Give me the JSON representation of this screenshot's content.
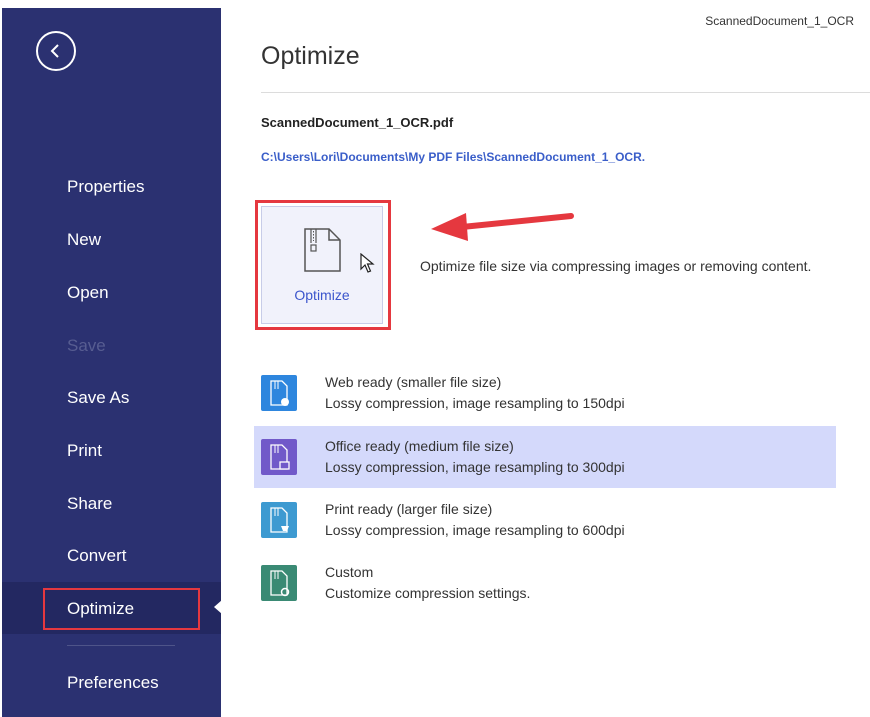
{
  "window": {
    "document_title": "ScannedDocument_1_OCR"
  },
  "sidebar": {
    "items": [
      {
        "label": "Properties",
        "enabled": true
      },
      {
        "label": "New",
        "enabled": true
      },
      {
        "label": "Open",
        "enabled": true
      },
      {
        "label": "Save",
        "enabled": false
      },
      {
        "label": "Save As",
        "enabled": true
      },
      {
        "label": "Print",
        "enabled": true
      },
      {
        "label": "Share",
        "enabled": true
      },
      {
        "label": "Convert",
        "enabled": true
      },
      {
        "label": "Optimize",
        "enabled": true,
        "selected": true
      },
      {
        "label": "Preferences",
        "enabled": true
      }
    ]
  },
  "main": {
    "title": "Optimize",
    "file_name": "ScannedDocument_1_OCR.pdf",
    "file_path": "C:\\Users\\Lori\\Documents\\My PDF Files\\ScannedDocument_1_OCR.",
    "optimize_button_label": "Optimize",
    "optimize_description": "Optimize file size via compressing images or removing content.",
    "presets": [
      {
        "title": "Web ready (smaller file size)",
        "subtitle": "Lossy compression, image resampling to 150dpi",
        "icon": "web-ready-icon",
        "color": "#2e86de",
        "selected": false
      },
      {
        "title": "Office ready (medium file size)",
        "subtitle": "Lossy compression, image resampling to 300dpi",
        "icon": "office-ready-icon",
        "color": "#7159c9",
        "selected": true
      },
      {
        "title": "Print ready (larger file size)",
        "subtitle": "Lossy compression, image resampling to 600dpi",
        "icon": "print-ready-icon",
        "color": "#3d9ad1",
        "selected": false
      },
      {
        "title": "Custom",
        "subtitle": "Customize compression settings.",
        "icon": "custom-icon",
        "color": "#3a8a74",
        "selected": false
      }
    ]
  },
  "colors": {
    "sidebar_bg": "#2b3171",
    "highlight_red": "#e5383f",
    "accent_blue": "#3b55cc",
    "selected_row": "#d4d9fb"
  }
}
